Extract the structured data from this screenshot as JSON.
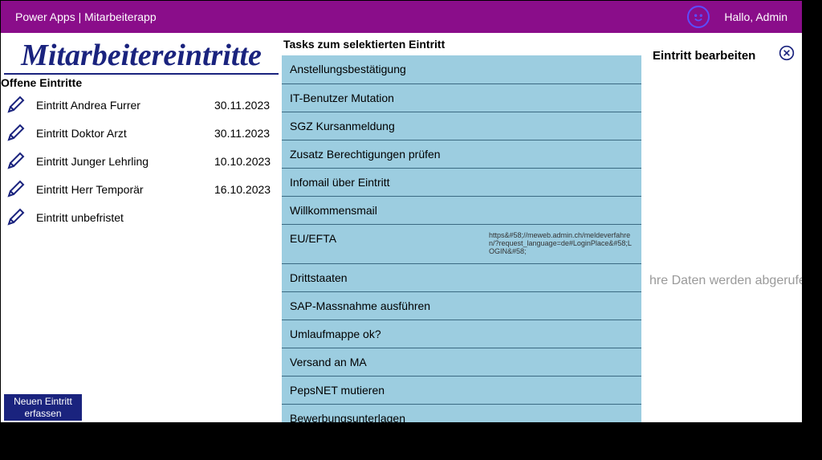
{
  "header": {
    "app_title": "Power Apps | Mitarbeiterapp",
    "greeting": "Hallo, Admin"
  },
  "left": {
    "page_title": "Mitarbeitereintritte",
    "section_label": "Offene Eintritte",
    "entries": [
      {
        "name": "Eintritt Andrea Furrer",
        "date": "30.11.2023"
      },
      {
        "name": "Eintritt Doktor Arzt",
        "date": "30.11.2023"
      },
      {
        "name": "Eintritt Junger Lehrling",
        "date": "10.10.2023"
      },
      {
        "name": "Eintritt Herr Temporär",
        "date": "16.10.2023"
      },
      {
        "name": "Eintritt unbefristet",
        "date": ""
      }
    ],
    "new_entry_button": "Neuen Eintritt erfassen"
  },
  "tasks": {
    "heading": "Tasks zum selektierten Eintritt",
    "items": [
      {
        "label": "Anstellungsbestätigung",
        "note": ""
      },
      {
        "label": "IT-Benutzer Mutation",
        "note": ""
      },
      {
        "label": "SGZ Kursanmeldung",
        "note": ""
      },
      {
        "label": "Zusatz Berechtigungen prüfen",
        "note": ""
      },
      {
        "label": "Infomail über Eintritt",
        "note": ""
      },
      {
        "label": "Willkommensmail",
        "note": ""
      },
      {
        "label": "EU/EFTA",
        "note": "https&#58;//meweb.admin.ch/meldeverfahren/?request_language=de#LoginPlace&#58;LOGIN&#58;"
      },
      {
        "label": "Drittstaaten",
        "note": ""
      },
      {
        "label": "SAP-Massnahme ausführen",
        "note": ""
      },
      {
        "label": "Umlaufmappe ok?",
        "note": ""
      },
      {
        "label": "Versand an MA",
        "note": ""
      },
      {
        "label": "PepsNET mutieren",
        "note": ""
      },
      {
        "label": "Bewerbungsunterlagen",
        "note": ""
      },
      {
        "label": "",
        "note": ""
      }
    ]
  },
  "right": {
    "heading": "Eintritt bearbeiten",
    "loading_text": "hre Daten werden abgerufen."
  }
}
